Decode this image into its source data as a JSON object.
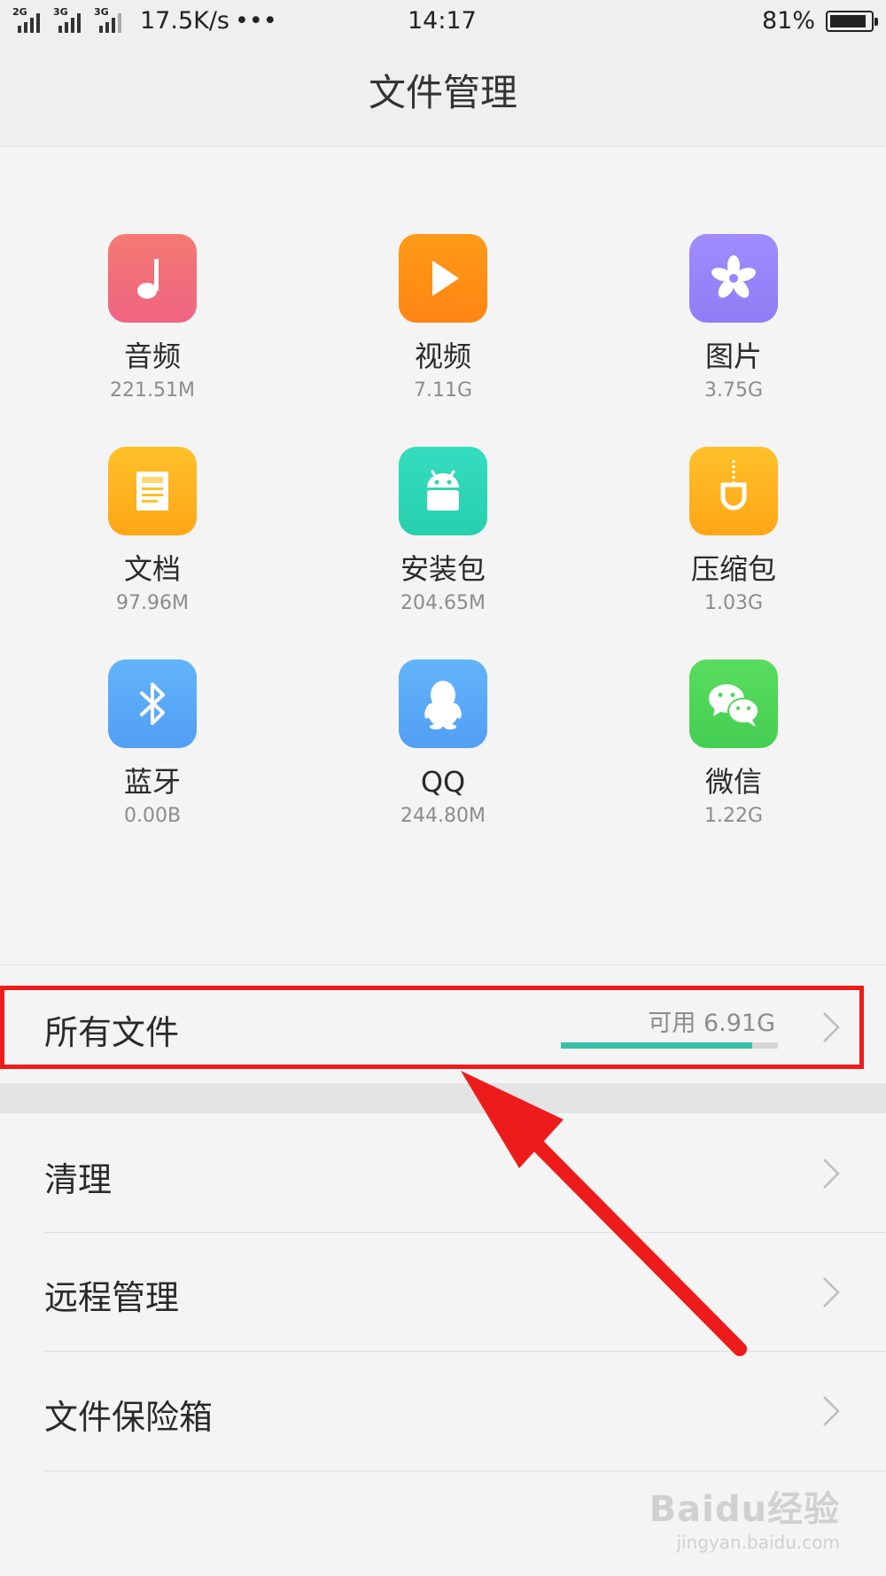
{
  "status_bar": {
    "sim1_tag": "2G",
    "sim2_tag": "3G",
    "sim3_tag": "3G",
    "net_speed": "17.5K/s",
    "more": "•••",
    "time": "14:17",
    "battery_percent": "81%",
    "battery_level": 0.81
  },
  "header": {
    "title": "文件管理"
  },
  "categories": [
    {
      "name": "音频",
      "size": "221.51M",
      "icon": "music-note-icon",
      "color": "#f2707b"
    },
    {
      "name": "视频",
      "size": "7.11G",
      "icon": "play-icon",
      "color": "#ff8f16"
    },
    {
      "name": "图片",
      "size": "3.75G",
      "icon": "flower-icon",
      "color": "#9b84ff"
    },
    {
      "name": "文档",
      "size": "97.96M",
      "icon": "document-icon",
      "color": "#ffb31f"
    },
    {
      "name": "安装包",
      "size": "204.65M",
      "icon": "android-icon",
      "color": "#2fd6b7"
    },
    {
      "name": "压缩包",
      "size": "1.03G",
      "icon": "zip-icon",
      "color": "#ffb31f"
    },
    {
      "name": "蓝牙",
      "size": "0.00B",
      "icon": "bluetooth-icon",
      "color": "#5aaaf8"
    },
    {
      "name": "QQ",
      "size": "244.80M",
      "icon": "qq-penguin-icon",
      "color": "#5aaaf8"
    },
    {
      "name": "微信",
      "size": "1.22G",
      "icon": "wechat-icon",
      "color": "#4fd65b"
    }
  ],
  "all_files": {
    "label": "所有文件",
    "available": "可用 6.91G",
    "used_fraction": 0.88
  },
  "menu": {
    "clean": "清理",
    "remote": "远程管理",
    "vault": "文件保险箱"
  },
  "watermark": {
    "line1": "Baidu经验",
    "line2": "jingyan.baidu.com"
  },
  "colors": {
    "accent_bar": "#39bfa9",
    "highlight": "#ee1b1b"
  }
}
